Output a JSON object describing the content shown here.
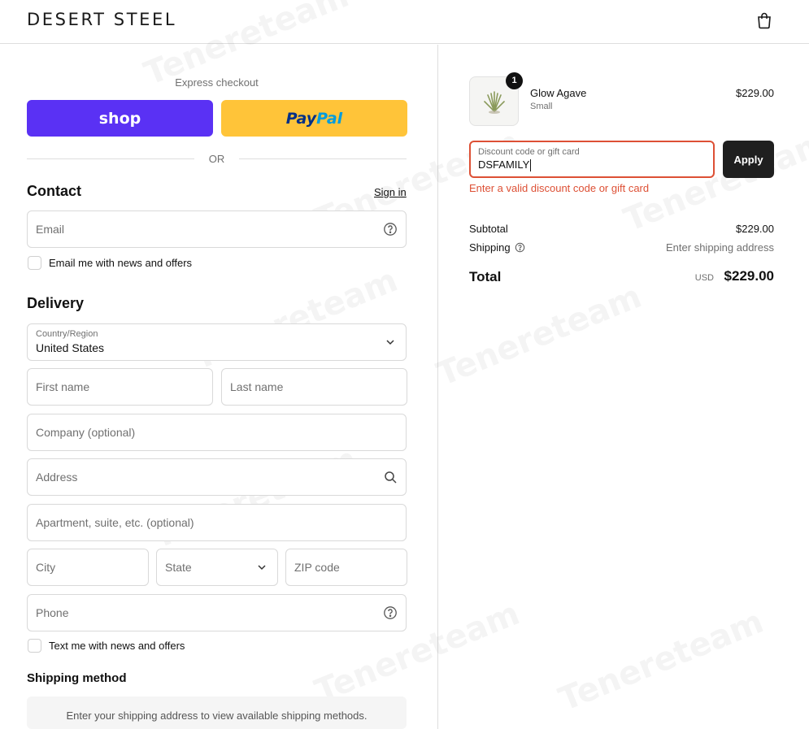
{
  "header": {
    "brand": "DESERT STEEL",
    "cart_icon": "shopping-bag-icon"
  },
  "express": {
    "title": "Express checkout",
    "shop_label": "shop",
    "paypal_pay": "Pay",
    "paypal_pal": "Pal",
    "divider": "OR"
  },
  "contact": {
    "title": "Contact",
    "signin": "Sign in",
    "email_placeholder": "Email",
    "newsletter_label": "Email me with news and offers"
  },
  "delivery": {
    "title": "Delivery",
    "country_label": "Country/Region",
    "country_value": "United States",
    "first_name": "First name",
    "last_name": "Last name",
    "company": "Company (optional)",
    "address": "Address",
    "apartment": "Apartment, suite, etc. (optional)",
    "city": "City",
    "state": "State",
    "zip": "ZIP code",
    "phone": "Phone",
    "sms_label": "Text me with news and offers"
  },
  "shipping_method": {
    "title": "Shipping method",
    "notice": "Enter your shipping address to view available shipping methods."
  },
  "order": {
    "product": {
      "name": "Glow Agave",
      "variant": "Small",
      "price": "$229.00",
      "quantity": "1"
    },
    "discount": {
      "label": "Discount code or gift card",
      "value": "DSFAMILY",
      "apply": "Apply",
      "error": "Enter a valid discount code or gift card"
    },
    "subtotal_label": "Subtotal",
    "subtotal_value": "$229.00",
    "shipping_label": "Shipping",
    "shipping_value": "Enter shipping address",
    "total_label": "Total",
    "total_currency": "USD",
    "total_value": "$229.00"
  },
  "colors": {
    "shop_purple": "#5a31f4",
    "paypal_yellow": "#ffc439",
    "error_red": "#dd5035",
    "apply_dark": "#1f1f1f"
  },
  "watermark": "Tenereteam"
}
